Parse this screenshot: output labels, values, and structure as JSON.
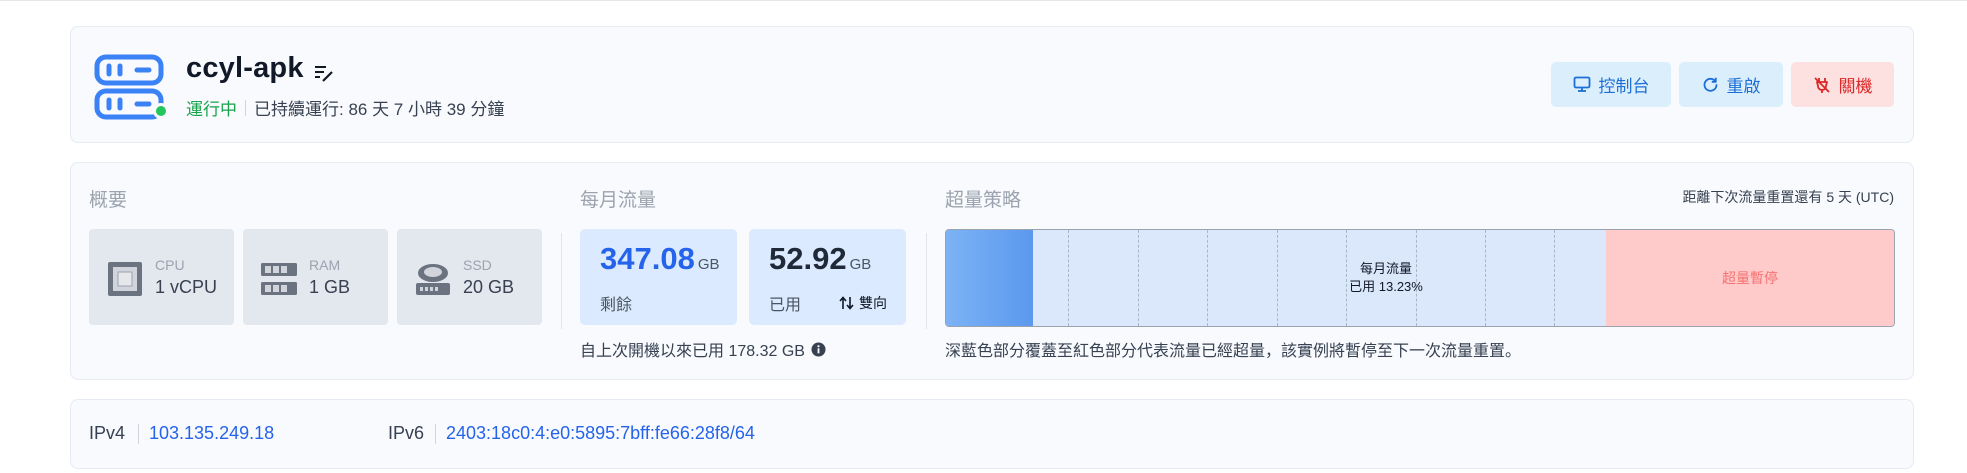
{
  "server": {
    "name": "ccyl-apk",
    "status": "運行中",
    "uptime": "已持續運行: 86 天 7 小時 39 分鐘"
  },
  "actions": {
    "console": "控制台",
    "reboot": "重啟",
    "shutdown": "關機"
  },
  "overview": {
    "title": "概要",
    "specs": [
      {
        "label": "CPU",
        "value": "1 vCPU",
        "icon": "cpu-icon"
      },
      {
        "label": "RAM",
        "value": "1 GB",
        "icon": "ram-icon"
      },
      {
        "label": "SSD",
        "value": "20 GB",
        "icon": "ssd-icon"
      }
    ]
  },
  "traffic": {
    "title": "每月流量",
    "remaining": {
      "value": "347.08",
      "unit": "GB",
      "label": "剩餘"
    },
    "used": {
      "value": "52.92",
      "unit": "GB",
      "label": "已用",
      "direction": "雙向"
    },
    "since_boot": "自上次開機以來已用 178.32 GB"
  },
  "policy": {
    "title": "超量策略",
    "reset_note": "距離下次流量重置還有 5 天 (UTC)",
    "bar_title": "每月流量",
    "bar_used": "已用 13.23%",
    "used_fraction": 0.1323,
    "over_label": "超量暫停",
    "note": "深藍色部分覆蓋至紅色部分代表流量已經超量，該實例將暫停至下一次流量重置。"
  },
  "network": {
    "ipv4_label": "IPv4",
    "ipv4": "103.135.249.18",
    "ipv6_label": "IPv6",
    "ipv6": "2403:18c0:4:e0:5895:7bff:fe66:28f8/64"
  },
  "colors": {
    "accent": "#2563eb",
    "running": "#16a34a",
    "danger": "#dc2626"
  }
}
